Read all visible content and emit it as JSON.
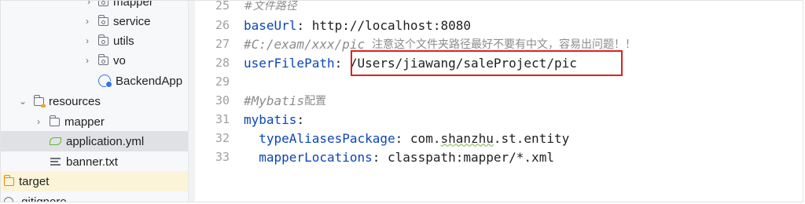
{
  "tree": {
    "items": [
      {
        "label": "mapper",
        "kind": "package"
      },
      {
        "label": "service",
        "kind": "package"
      },
      {
        "label": "utils",
        "kind": "package"
      },
      {
        "label": "vo",
        "kind": "package"
      },
      {
        "label": "BackendApp",
        "kind": "class"
      },
      {
        "label": "resources",
        "kind": "resources-folder"
      },
      {
        "label": "mapper",
        "kind": "folder"
      },
      {
        "label": "application.yml",
        "kind": "yml-file"
      },
      {
        "label": "banner.txt",
        "kind": "text-file"
      },
      {
        "label": "target",
        "kind": "folder"
      },
      {
        "label": ".gitignore",
        "kind": "file"
      }
    ]
  },
  "editor": {
    "lines": [
      {
        "num": "25",
        "comment": "#文件路径"
      },
      {
        "num": "26",
        "key": "baseUrl",
        "sep": ": ",
        "value": "http://localhost:8080"
      },
      {
        "num": "27",
        "comment": "#C:/exam/xxx/pic",
        "note": "  注意这个文件夹路径最好不要有中文，容易出问题！！"
      },
      {
        "num": "28",
        "key": "userFilePath",
        "sep": ": ",
        "value": "/Users/jiawang/saleProject/pic"
      },
      {
        "num": "29"
      },
      {
        "num": "30",
        "comment": "#Mybatis",
        "note": "配置"
      },
      {
        "num": "31",
        "key": "mybatis",
        "sep": ":"
      },
      {
        "num": "32",
        "indent": "  ",
        "key": "typeAliasesPackage",
        "sep": ": ",
        "value_pre": "com.",
        "value_typo": "shanzhu",
        "value_post": ".st.entity"
      },
      {
        "num": "33",
        "indent": "  ",
        "key": "mapperLocations",
        "sep": ": ",
        "value": "classpath:mapper/*.xml"
      }
    ]
  },
  "colors": {
    "key": "#0b46b8",
    "comment": "#8c8c8c",
    "highlight_border": "#e02020",
    "selected_row": "#dfe1e5"
  }
}
